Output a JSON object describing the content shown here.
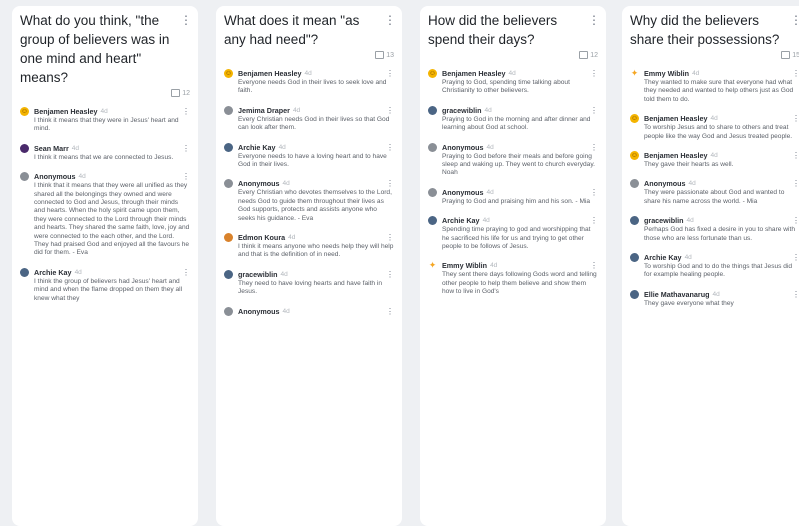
{
  "columns": [
    {
      "title": "What do you think, \"the group of believers was in one mind and heart\" means?",
      "comment_count": "12",
      "posts": [
        {
          "author": "Benjamen Heasley",
          "time": "4d",
          "avatar": "emoji",
          "body": "I think it means that they were in Jesus' heart and mind."
        },
        {
          "author": "Sean Marr",
          "time": "4d",
          "avatar": "purple",
          "body": "I think it means that we are connected to Jesus."
        },
        {
          "author": "Anonymous",
          "time": "4d",
          "avatar": "gray",
          "body": "I think that it means that they were all unified as they shared all the belongings they owned and were connected to God and Jesus, through their minds and hearts. When the holy spirit came upon them, they were connected to the Lord through their minds and hearts. They shared the same faith, love, joy and were connected to the each other, and the Lord. They had praised God and enjoyed all the favours he did for them. - Eva"
        },
        {
          "author": "Archie Kay",
          "time": "4d",
          "avatar": "blue",
          "body": "I think the group of believers had Jesus' heart and mind and when the flame dropped on them they all knew what they"
        }
      ]
    },
    {
      "title": "What does it mean \"as any had need\"?",
      "comment_count": "13",
      "posts": [
        {
          "author": "Benjamen Heasley",
          "time": "4d",
          "avatar": "emoji",
          "body": "Everyone needs God in their lives to seek love and faith."
        },
        {
          "author": "Jemima Draper",
          "time": "4d",
          "avatar": "gray",
          "body": "Every Christian needs God in their lives so that God can look after them."
        },
        {
          "author": "Archie Kay",
          "time": "4d",
          "avatar": "blue",
          "body": "Everyone needs to have a loving heart and to have God in their lives."
        },
        {
          "author": "Anonymous",
          "time": "4d",
          "avatar": "gray",
          "body": "Every Christian who devotes themselves to the Lord, needs God to guide them throughout their lives as God supports, protects and assists anyone who seeks his guidance. - Eva"
        },
        {
          "author": "Edmon Koura",
          "time": "4d",
          "avatar": "orange",
          "body": "I think it means anyone who needs help they will help and that is the definition of in need."
        },
        {
          "author": "gracewiblin",
          "time": "4d",
          "avatar": "blue",
          "body": "They need to have loving hearts and have faith in Jesus."
        },
        {
          "author": "Anonymous",
          "time": "4d",
          "avatar": "gray",
          "body": ""
        }
      ]
    },
    {
      "title": "How did the believers spend their days?",
      "comment_count": "12",
      "posts": [
        {
          "author": "Benjamen Heasley",
          "time": "4d",
          "avatar": "emoji",
          "body": "Praying to God, spending time talking about Christianity to other believers."
        },
        {
          "author": "gracewiblin",
          "time": "4d",
          "avatar": "blue",
          "body": "Praying to God in the morning and after dinner and learning about God at school."
        },
        {
          "author": "Anonymous",
          "time": "4d",
          "avatar": "gray",
          "body": "Praying to God before their meals and before going sleep and waking up. They went to church everyday. Noah"
        },
        {
          "author": "Anonymous",
          "time": "4d",
          "avatar": "gray",
          "body": "Praying to God and praising him and his son. - Mia"
        },
        {
          "author": "Archie Kay",
          "time": "4d",
          "avatar": "blue",
          "body": "Spending time praying to god and worshipping that he sacrificed his life for us and trying to get other people to be follows of Jesus."
        },
        {
          "author": "Emmy Wiblin",
          "time": "4d",
          "avatar": "star",
          "body": "They sent there days following Gods word and telling other people to help them believe and show them how to live in God's"
        }
      ]
    },
    {
      "title": "Why did the believers share their possessions?",
      "comment_count": "15",
      "posts": [
        {
          "author": "Emmy Wiblin",
          "time": "4d",
          "avatar": "star",
          "body": "They wanted to make sure that everyone had what they needed and wanted to help others just as God told them to do."
        },
        {
          "author": "Benjamen Heasley",
          "time": "4d",
          "avatar": "emoji",
          "body": "To worship Jesus and to share to others and treat people like the way God and Jesus treated people."
        },
        {
          "author": "Benjamen Heasley",
          "time": "4d",
          "avatar": "emoji",
          "body": "They gave their hearts as well."
        },
        {
          "author": "Anonymous",
          "time": "4d",
          "avatar": "gray",
          "body": "They were passionate about God and wanted to share his name across the world. - Mia"
        },
        {
          "author": "gracewiblin",
          "time": "4d",
          "avatar": "blue",
          "body": "Perhaps God has fixed a desire in you to share with those who are less fortunate than us."
        },
        {
          "author": "Archie Kay",
          "time": "4d",
          "avatar": "blue",
          "body": "To worship God and to do the things that Jesus did for example healing people."
        },
        {
          "author": "Ellie Mathavanarug",
          "time": "4d",
          "avatar": "blue",
          "body": "They gave everyone what they"
        }
      ]
    }
  ],
  "colors": {
    "background": "#eef0f3",
    "card": "#ffffff",
    "title": "#1f2328",
    "body": "#5c6169",
    "emoji": "#f4b400",
    "purple": "#4a2a6b",
    "gray": "#8a8f96",
    "blue": "#4b6584",
    "orange": "#d9822b",
    "star": "#f5a623"
  }
}
